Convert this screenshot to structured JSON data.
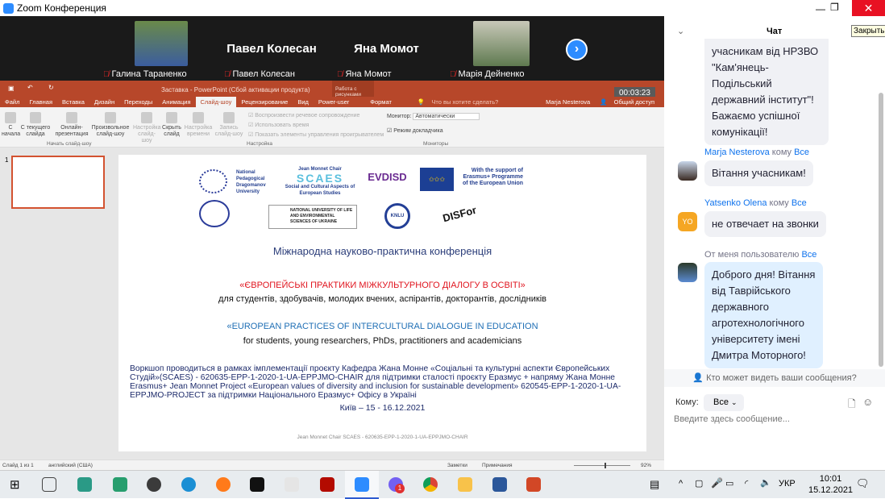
{
  "window": {
    "title": "Zoom Конференция",
    "close_tooltip": "Закрыть"
  },
  "videos": [
    {
      "name": "Галина Тараненко",
      "has_photo": true
    },
    {
      "name": "Павел Колесан",
      "display": "Павел Колесан"
    },
    {
      "name": "Яна Момот",
      "display": "Яна Момот"
    },
    {
      "name": "Марія Дейненко",
      "has_photo": true
    }
  ],
  "ppt": {
    "title": "Заставка - PowerPoint (Сбой активации продукта)",
    "context_tab": "Работа с рисунками",
    "timer": "00:03:23",
    "user": "Marja Nesterova",
    "share": "Общий доступ",
    "search": "Что вы хотите сделать?",
    "tabs": [
      "Файл",
      "Главная",
      "Вставка",
      "Дизайн",
      "Переходы",
      "Анимация",
      "Слайд-шоу",
      "Рецензирование",
      "Вид",
      "Power-user",
      "Формат"
    ],
    "active_tab": "Слайд-шоу",
    "ribbon": {
      "from_start": "С начала",
      "from_current": "С текущего слайда",
      "online": "Онлайн-презентация",
      "custom": "Произвольное слайд-шоу",
      "setup": "Настройка слайд-шоу",
      "hide": "Скрыть слайд",
      "timing": "Настройка времени",
      "record": "Запись слайд-шоу",
      "cb1": "Воспроизвести речевое сопровождение",
      "cb2": "Использовать время",
      "cb3": "Показать элементы управления проигрывателем",
      "monitor_label": "Монитор:",
      "monitor_value": "Автоматически",
      "presenter": "Режим докладчика",
      "group1": "Начать слайд-шоу",
      "group2": "Настройка",
      "group3": "Мониторы"
    },
    "thumb_number": "1",
    "slide": {
      "logos": {
        "npdu": "National Pedagogical Dragomanov University",
        "scaes_top": "Jean Monnet Chair",
        "scaes": "SCAES",
        "scaes_sub": "Social and Cultural Aspects of European Studies",
        "evdisd": "EVDISD",
        "erasmus": "With the support of Erasmus+ Programme of the European Union",
        "nubip": "NATIONAL UNIVERSITY OF LIFE AND ENVIRONMENTAL SCIENCES OF UKRAINE",
        "knlu": "KNLU",
        "disfor": "DISFor"
      },
      "heading": "Міжнародна науково-практична конференція",
      "title_ua": "«ЄВРОПЕЙСЬКІ ПРАКТИКИ МІЖКУЛЬТУРНОГО ДІАЛОГУ В ОСВІТІ»",
      "sub_ua": "для студентів, здобувачів, молодих вчених, аспірантів, докторантів, дослідників",
      "title_en": "«EUROPEAN PRACTICES OF INTERCULTURAL DIALOGUE IN EDUCATION",
      "sub_en": "for students, young researchers, PhDs, practitioners and academicians",
      "body": "Воркшоп проводиться в рамках імплементації проєкту Кафедра Жана Монне «Соціальні та культурні аспекти Європейських Студій»(SCAES) - 620635-EPP-1-2020-1-UA-EPPJMO-CHAIR для підтримки сталості проєкту  Еразмус + напряму Жана Монне Erasmus+ Jean Monnet Project «European values of diversity and inclusion for sustainable development»  620545-EPP-1-2020-1-UA-EPPJMO-PROJECT за підтримки Національного Еразмус+ Офісу в Україні",
      "date": "Київ – 15 - 16.12.2021",
      "footer": "Jean Monnet Chair SCAES - 620635-EPP-1-2020-1-UA-EPPJMO-CHAIR"
    },
    "status": {
      "slide": "Слайд 1 из 1",
      "lang": "английский (США)",
      "notes": "Заметки",
      "comments": "Примечания",
      "zoom": "92%",
      "zoom_level": 92
    }
  },
  "chat": {
    "title": "Чат",
    "messages": [
      {
        "text": "учасникам від НРЗВО \"Кам'янець-Подільський державний інститут\"! Бажаємо успішної комунікації!"
      },
      {
        "sender": "Marja Nesterova",
        "to_word": "кому",
        "to": "Все",
        "text": "Вітання учасникам!"
      },
      {
        "sender": "Yatsenko Olena",
        "initials": "YO",
        "to_word": "кому",
        "to": "Все",
        "text": "не отвечает на звонки"
      },
      {
        "sender": "От меня пользователю",
        "to": "Все",
        "text": "Доброго дня! Вітання від Таврійського державного агротехнологічного університету імені Дмитра Моторного!"
      }
    ],
    "who_can_see": "Кто может видеть ваши сообщения?",
    "to_label": "Кому:",
    "to_value": "Все",
    "placeholder": "Введите здесь сообщение..."
  },
  "taskbar": {
    "lang": "УКР",
    "time": "10:01",
    "date": "15.12.2021",
    "viber_badge": "1"
  },
  "colors": {
    "ppt": "#b7472a",
    "zoom": "#2d8cff",
    "close": "#e81123"
  }
}
